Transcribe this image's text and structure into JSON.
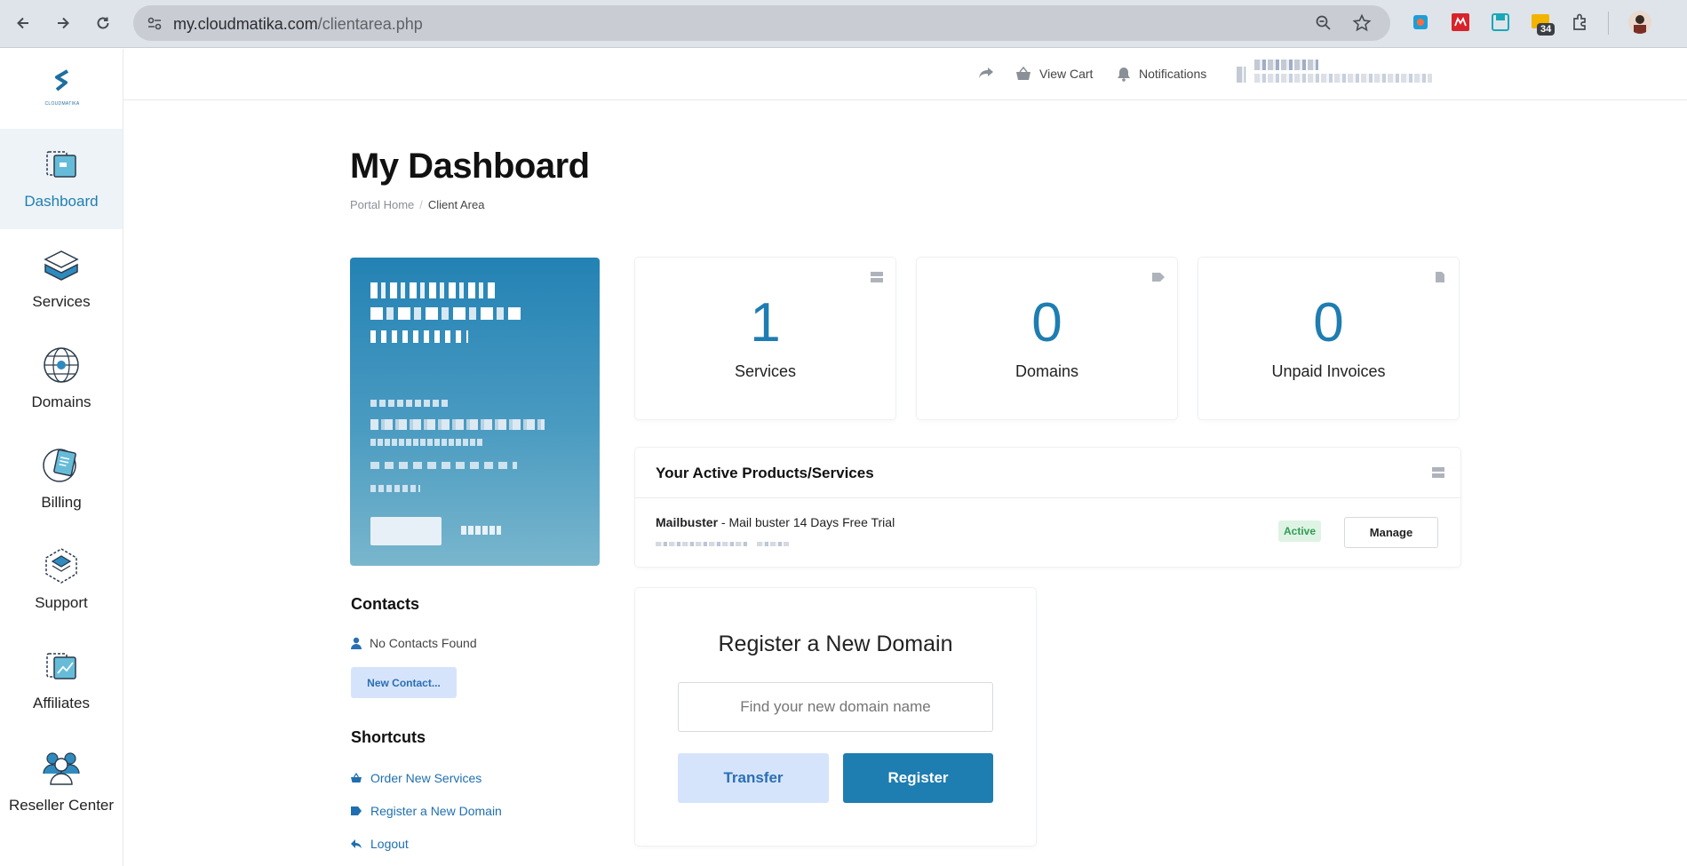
{
  "browser": {
    "url_domain": "my.cloudmatika.com",
    "url_path": "/clientarea.php",
    "extension_badge": "34"
  },
  "sidebar": {
    "logo_text": "CLOUDMATIKA",
    "items": [
      {
        "label": "Dashboard",
        "icon": "dashboard-icon",
        "active": true
      },
      {
        "label": "Services",
        "icon": "services-icon"
      },
      {
        "label": "Domains",
        "icon": "globe-icon"
      },
      {
        "label": "Billing",
        "icon": "billing-icon"
      },
      {
        "label": "Support",
        "icon": "support-icon"
      },
      {
        "label": "Affiliates",
        "icon": "affiliates-icon"
      },
      {
        "label": "Reseller Center",
        "icon": "reseller-icon"
      }
    ]
  },
  "header": {
    "view_cart": "View Cart",
    "notifications": "Notifications"
  },
  "page": {
    "title": "My Dashboard",
    "breadcrumb": [
      "Portal Home",
      "Client Area"
    ]
  },
  "stats": [
    {
      "value": "1",
      "label": "Services"
    },
    {
      "value": "0",
      "label": "Domains"
    },
    {
      "value": "0",
      "label": "Unpaid Invoices"
    }
  ],
  "products": {
    "title": "Your Active Products/Services",
    "item_name": "Mailbuster",
    "item_desc": " - Mail buster 14 Days Free Trial",
    "status": "Active",
    "manage_label": "Manage"
  },
  "contacts": {
    "title": "Contacts",
    "empty_text": "No Contacts Found",
    "new_button": "New Contact..."
  },
  "shortcuts": {
    "title": "Shortcuts",
    "items": [
      "Order New Services",
      "Register a New Domain",
      "Logout"
    ]
  },
  "domain_search": {
    "title": "Register a New Domain",
    "placeholder": "Find your new domain name",
    "transfer_label": "Transfer",
    "register_label": "Register"
  },
  "colors": {
    "accent": "#1e7db1",
    "accent_light": "#d6e4fb",
    "success": "#2e9d52"
  }
}
